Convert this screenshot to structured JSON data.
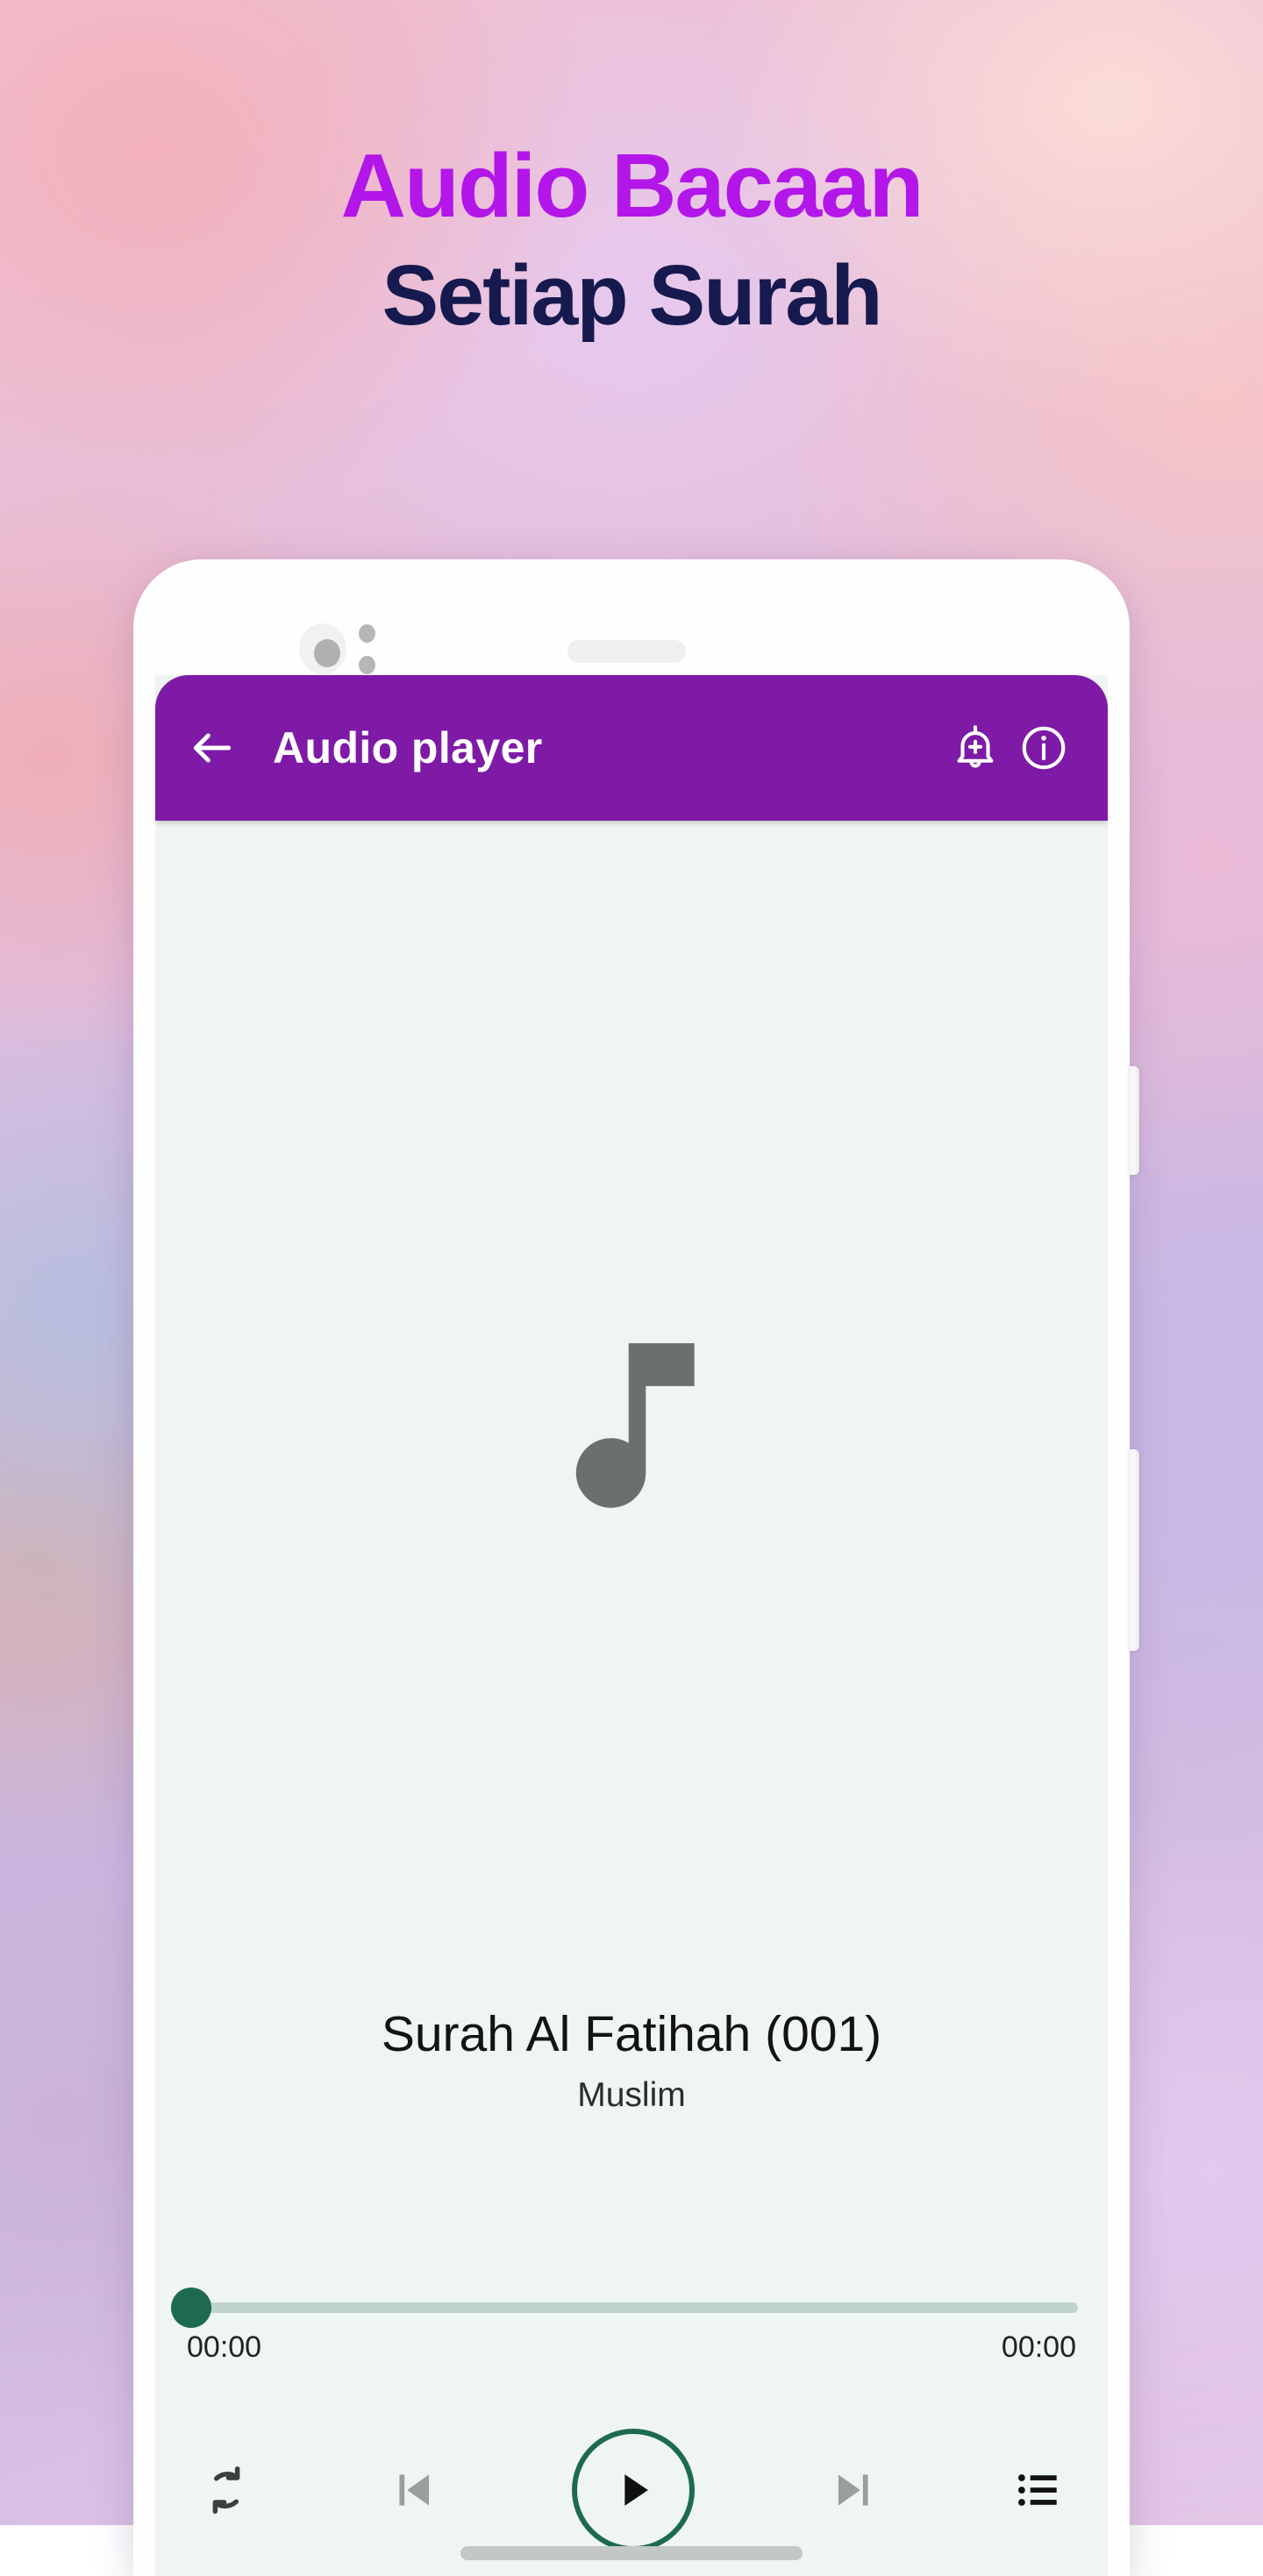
{
  "promo": {
    "headline_line1": "Audio Bacaan",
    "headline_line2": "Setiap Surah",
    "colors": {
      "headline_primary": "#b316e8",
      "headline_secondary": "#161a4e",
      "appbar": "#7e1aa6",
      "accent_green": "#1e6a4f",
      "screen_bg": "#eff5f2"
    }
  },
  "app": {
    "appbar": {
      "back_icon": "back-arrow-icon",
      "title": "Audio player",
      "actions": [
        {
          "icon": "bell-plus-icon",
          "label": "Add reminder"
        },
        {
          "icon": "info-circle-icon",
          "label": "Information"
        }
      ]
    },
    "artwork": {
      "icon": "music-note-icon"
    },
    "track": {
      "title": "Surah Al Fatihah (001)",
      "artist": "Muslim"
    },
    "seek": {
      "value_percent": 0,
      "elapsed": "00:00",
      "duration": "00:00"
    },
    "controls": [
      {
        "name": "repeat-button",
        "icon": "repeat-icon"
      },
      {
        "name": "previous-button",
        "icon": "skip-previous-icon"
      },
      {
        "name": "play-button",
        "icon": "play-icon"
      },
      {
        "name": "next-button",
        "icon": "skip-next-icon"
      },
      {
        "name": "playlist-button",
        "icon": "playlist-icon"
      }
    ]
  },
  "device": {
    "camera": "front-camera",
    "earpiece": "earpiece-speaker",
    "buttons": [
      "power-button",
      "volume-rocker"
    ],
    "home_indicator": "home-indicator"
  }
}
